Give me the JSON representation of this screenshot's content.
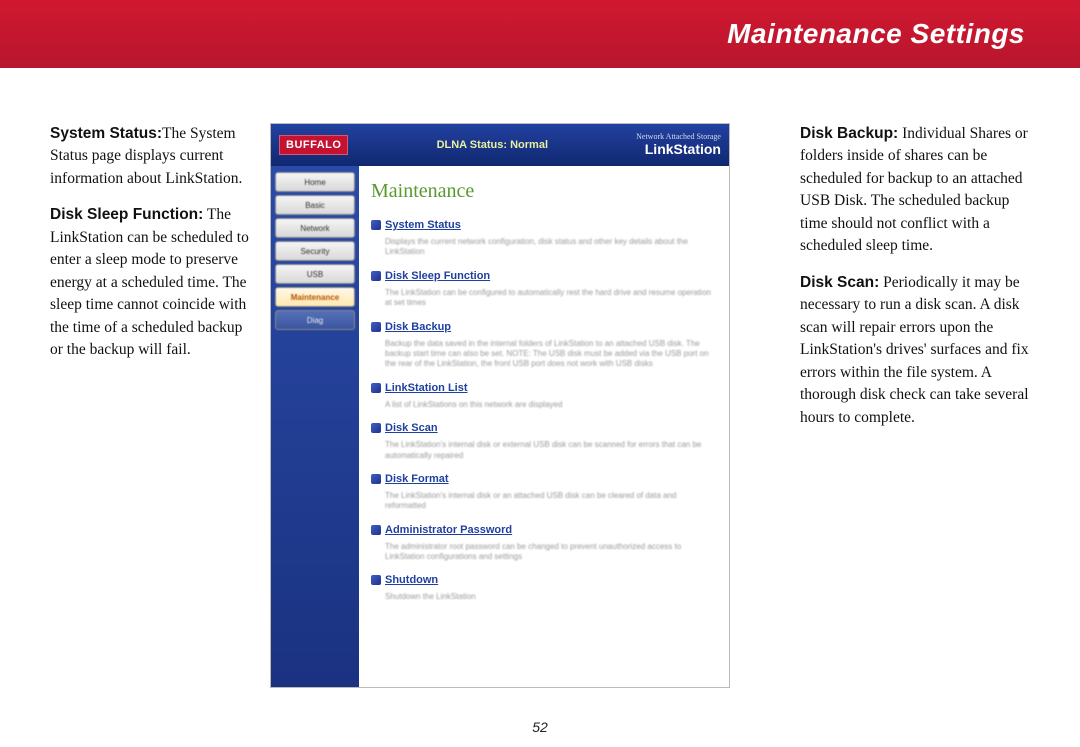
{
  "header": {
    "title": "Maintenance Settings"
  },
  "left_column": {
    "p1_bold": "System Status:",
    "p1_rest": "The System Status page displays current information about LinkStation.",
    "p2_bold": "Disk Sleep Function:",
    "p2_rest": " The LinkStation can be scheduled to enter a sleep mode to preserve energy at a scheduled time. The sleep time cannot coincide with the time of a scheduled backup or the backup will fail."
  },
  "right_column": {
    "p1_bold": "Disk Backup:",
    "p1_rest": "  Individual Shares or folders inside of shares can be scheduled for backup to an attached USB Disk.  The scheduled backup time should not conflict with a scheduled sleep time.",
    "p2_bold": "Disk Scan:",
    "p2_rest": "  Periodically it may be necessary to run a disk scan.  A disk scan will repair errors upon the LinkStation's drives' surfaces and fix errors within the file system.  A thorough disk check can take several hours to complete."
  },
  "screenshot": {
    "logo": "BUFFALO",
    "status": "DLNA Status: Normal",
    "brand_small": "Network Attached Storage",
    "brand": "LinkStation",
    "sidebar": {
      "home": "Home",
      "basic": "Basic",
      "network": "Network",
      "security": "Security",
      "usb": "USB",
      "maintenance": "Maintenance",
      "diag": "Diag"
    },
    "page_title": "Maintenance",
    "items": {
      "system_status": {
        "label": "System Status",
        "desc": "Displays the current network configuration, disk status and other key details about the LinkStation"
      },
      "disk_sleep": {
        "label": "Disk Sleep Function",
        "desc": "The LinkStation can be configured to automatically rest the hard drive and resume operation at set times"
      },
      "disk_backup": {
        "label": "Disk Backup",
        "desc": "Backup the data saved in the internal folders of LinkStation to an attached USB disk. The backup start time can also be set. NOTE: The USB disk must be added via the USB port on the rear of the LinkStation, the front USB port does not work with USB disks"
      },
      "linkstation_list": {
        "label": "LinkStation List",
        "desc": "A list of LinkStations on this network are displayed"
      },
      "disk_scan": {
        "label": "Disk Scan",
        "desc": "The LinkStation's internal disk or external USB disk can be scanned for errors that can be automatically repaired"
      },
      "disk_format": {
        "label": "Disk Format",
        "desc": "The LinkStation's internal disk or an attached USB disk can be cleared of data and reformatted"
      },
      "admin_password": {
        "label": "Administrator Password",
        "desc": "The administrator root password can be changed to prevent unauthorized access to LinkStation configurations and settings"
      },
      "shutdown": {
        "label": "Shutdown",
        "desc": "Shutdown the LinkStation"
      }
    }
  },
  "page_number": "52"
}
